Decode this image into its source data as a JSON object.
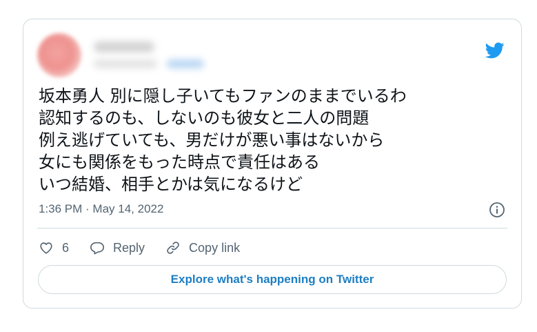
{
  "tweet": {
    "text": "坂本勇人 別に隠し子いてもファンのままでいるわ\n認知するのも、しないのも彼女と二人の問題\n例え逃げていても、男だけが悪い事はないから\n女にも関係をもった時点で責任はある\nいつ結婚、相手とかは気になるけど",
    "timestamp": "1:36 PM · May 14, 2022"
  },
  "actions": {
    "like_count": "6",
    "reply_label": "Reply",
    "copy_link_label": "Copy link"
  },
  "cta": {
    "label": "Explore what's happening on Twitter"
  },
  "icons": {
    "brand": "twitter-bird-icon",
    "info": "info-icon",
    "like": "heart-icon",
    "reply": "speech-bubble-icon",
    "copy_link": "link-icon"
  },
  "colors": {
    "brand": "#1d9bf0",
    "link_text": "#1d7ec2",
    "primary_text": "#0f1419",
    "secondary_text": "#536471",
    "border": "#cfd9de"
  }
}
